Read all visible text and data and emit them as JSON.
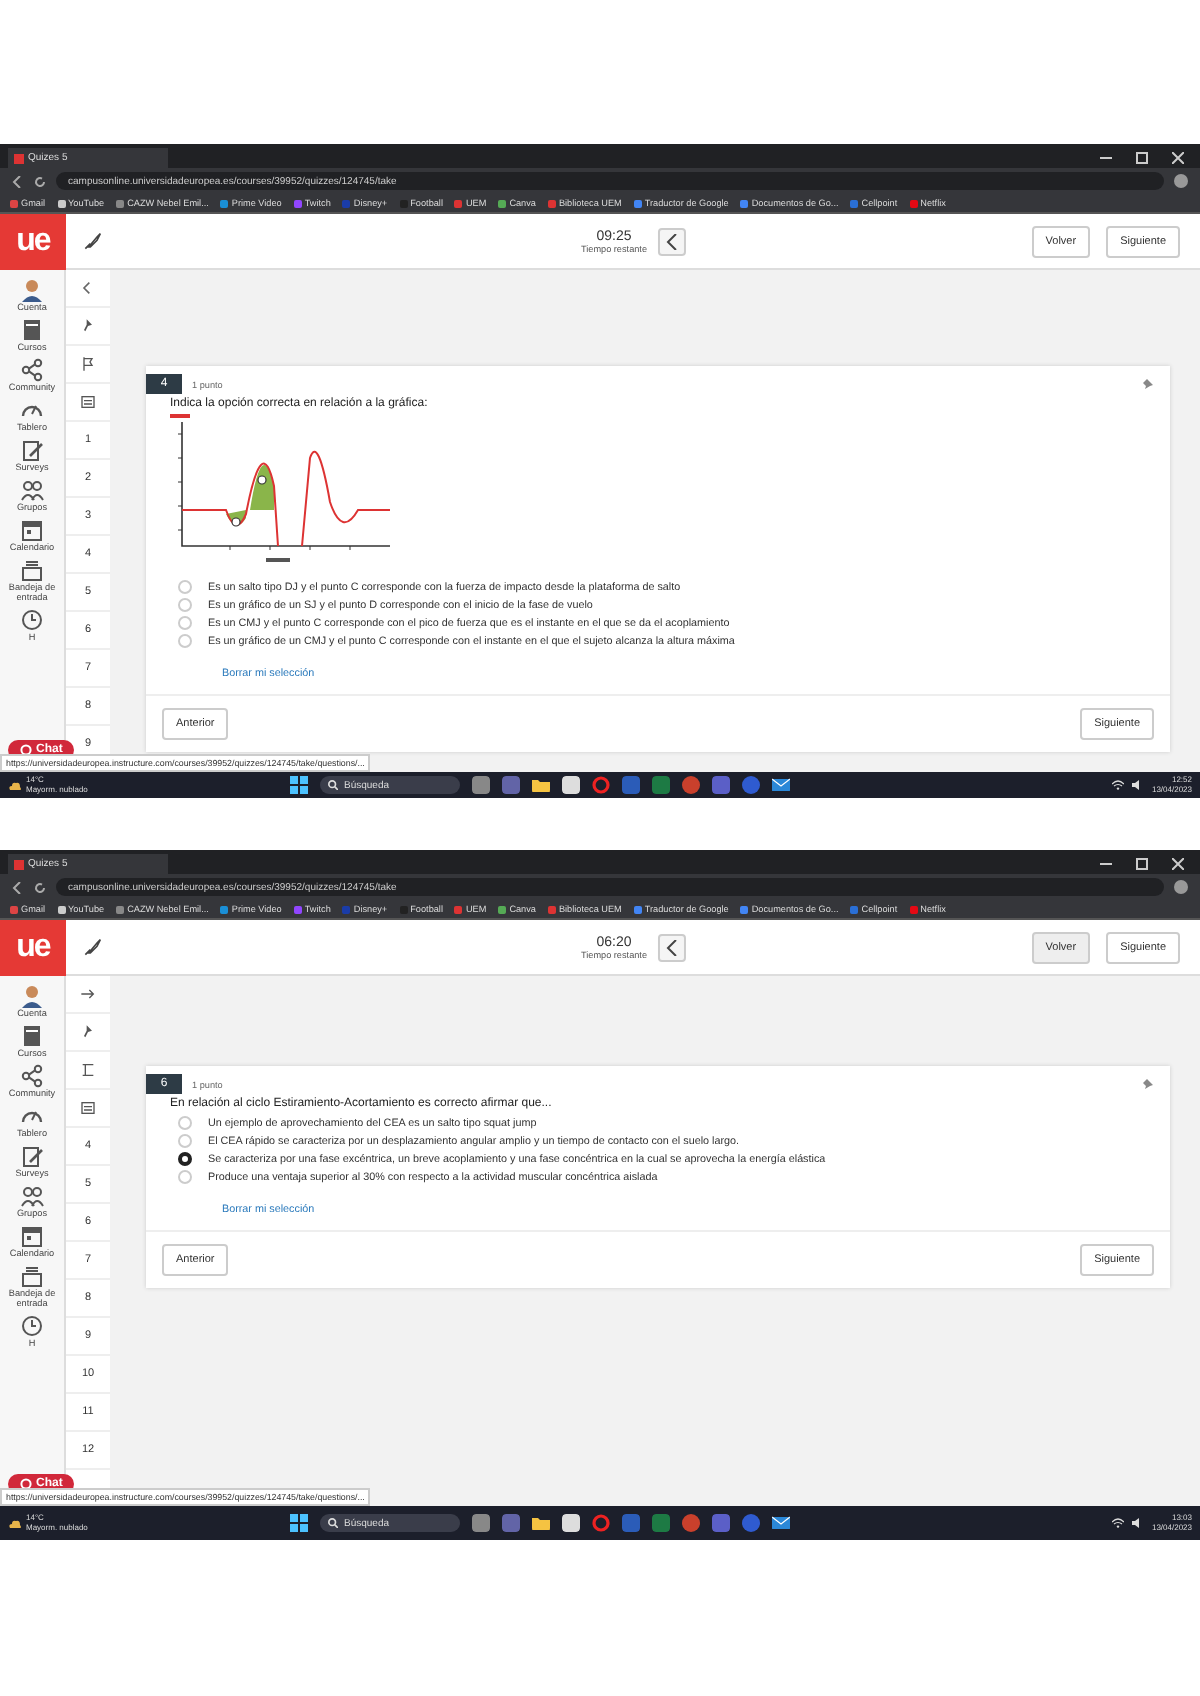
{
  "shots": [
    {
      "tab_title": "Quizes 5",
      "url": "campusonline.universidadeuropea.es/courses/39952/quizzes/124745/take",
      "bookmarks": [
        "Gmail",
        "YouTube",
        "CAZW Nebel Emil...",
        "Prime Video",
        "Twitch",
        "Disney+",
        "Football",
        "UEM",
        "Canva",
        "Biblioteca UEM",
        "Traductor de Google",
        "Documentos de Go...",
        "Cellpoint",
        "Netflix"
      ],
      "logo": "ue",
      "timer": "09:25",
      "timer_label": "Tiempo restante",
      "back_button": "Volver",
      "next_header_button": "Siguiente",
      "rail_items": [
        "Cuenta",
        "Cursos",
        "Community",
        "Tablero",
        "Surveys",
        "Grupos",
        "Calendario",
        "Bandeja de entrada",
        "H"
      ],
      "question_numbers": [
        "1",
        "2",
        "3",
        "4",
        "5",
        "6",
        "7",
        "8",
        "9"
      ],
      "question": {
        "number": "4",
        "points": "1 punto",
        "prompt": "Indica la opción correcta en relación a la gráfica:",
        "has_graph": true,
        "options": [
          {
            "text": "Es un salto tipo DJ y el punto C corresponde con la fuerza de impacto desde la plataforma de salto",
            "selected": false
          },
          {
            "text": "Es un gráfico de un SJ y el punto D corresponde con el inicio de la fase de vuelo",
            "selected": false
          },
          {
            "text": "Es un CMJ y el punto C corresponde con el pico de fuerza que es el instante en el que se da el acoplamiento",
            "selected": false
          },
          {
            "text": "Es un gráfico de un CMJ y el punto C corresponde con el instante en el que el sujeto alcanza la altura máxima",
            "selected": false
          }
        ],
        "clear_link": "Borrar mi selección"
      },
      "prev_button": "Anterior",
      "next_button": "Siguiente",
      "chat": "Chat",
      "status_url": "https://universidadeuropea.instructure.com/courses/39952/quizzes/124745/take/questions/...",
      "taskbar": {
        "temp": "14°C",
        "weather": "Mayorm. nublado",
        "search": "Búsqueda",
        "time": "12:52",
        "date": "13/04/2023"
      }
    },
    {
      "tab_title": "Quizes 5",
      "url": "campusonline.universidadeuropea.es/courses/39952/quizzes/124745/take",
      "bookmarks": [
        "Gmail",
        "YouTube",
        "CAZW Nebel Emil...",
        "Prime Video",
        "Twitch",
        "Disney+",
        "Football",
        "UEM",
        "Canva",
        "Biblioteca UEM",
        "Traductor de Google",
        "Documentos de Go...",
        "Cellpoint",
        "Netflix"
      ],
      "logo": "ue",
      "timer": "06:20",
      "timer_label": "Tiempo restante",
      "back_button": "Volver",
      "next_header_button": "Siguiente",
      "rail_items": [
        "Cuenta",
        "Cursos",
        "Community",
        "Tablero",
        "Surveys",
        "Grupos",
        "Calendario",
        "Bandeja de entrada",
        "H"
      ],
      "question_numbers": [
        "4",
        "5",
        "6",
        "7",
        "8",
        "9",
        "10",
        "11",
        "12"
      ],
      "question": {
        "number": "6",
        "points": "1 punto",
        "prompt": "En relación al ciclo Estiramiento-Acortamiento es correcto afirmar que...",
        "has_graph": false,
        "options": [
          {
            "text": "Un ejemplo de aprovechamiento del CEA es un salto tipo squat jump",
            "selected": false
          },
          {
            "text": "El CEA rápido se caracteriza por un desplazamiento angular amplio y un tiempo de contacto con el suelo largo.",
            "selected": false
          },
          {
            "text": "Se caracteriza por una fase excéntrica, un breve acoplamiento y una fase concéntrica en la cual se aprovecha la energía elástica",
            "selected": true
          },
          {
            "text": "Produce una ventaja superior al 30% con respecto a la actividad muscular concéntrica aislada",
            "selected": false
          }
        ],
        "clear_link": "Borrar mi selección"
      },
      "prev_button": "Anterior",
      "next_button": "Siguiente",
      "chat": "Chat",
      "status_url": "https://universidadeuropea.instructure.com/courses/39952/quizzes/124745/take/questions/...",
      "taskbar": {
        "temp": "14°C",
        "weather": "Mayorm. nublado",
        "search": "Búsqueda",
        "time": "13:03",
        "date": "13/04/2023"
      }
    }
  ]
}
